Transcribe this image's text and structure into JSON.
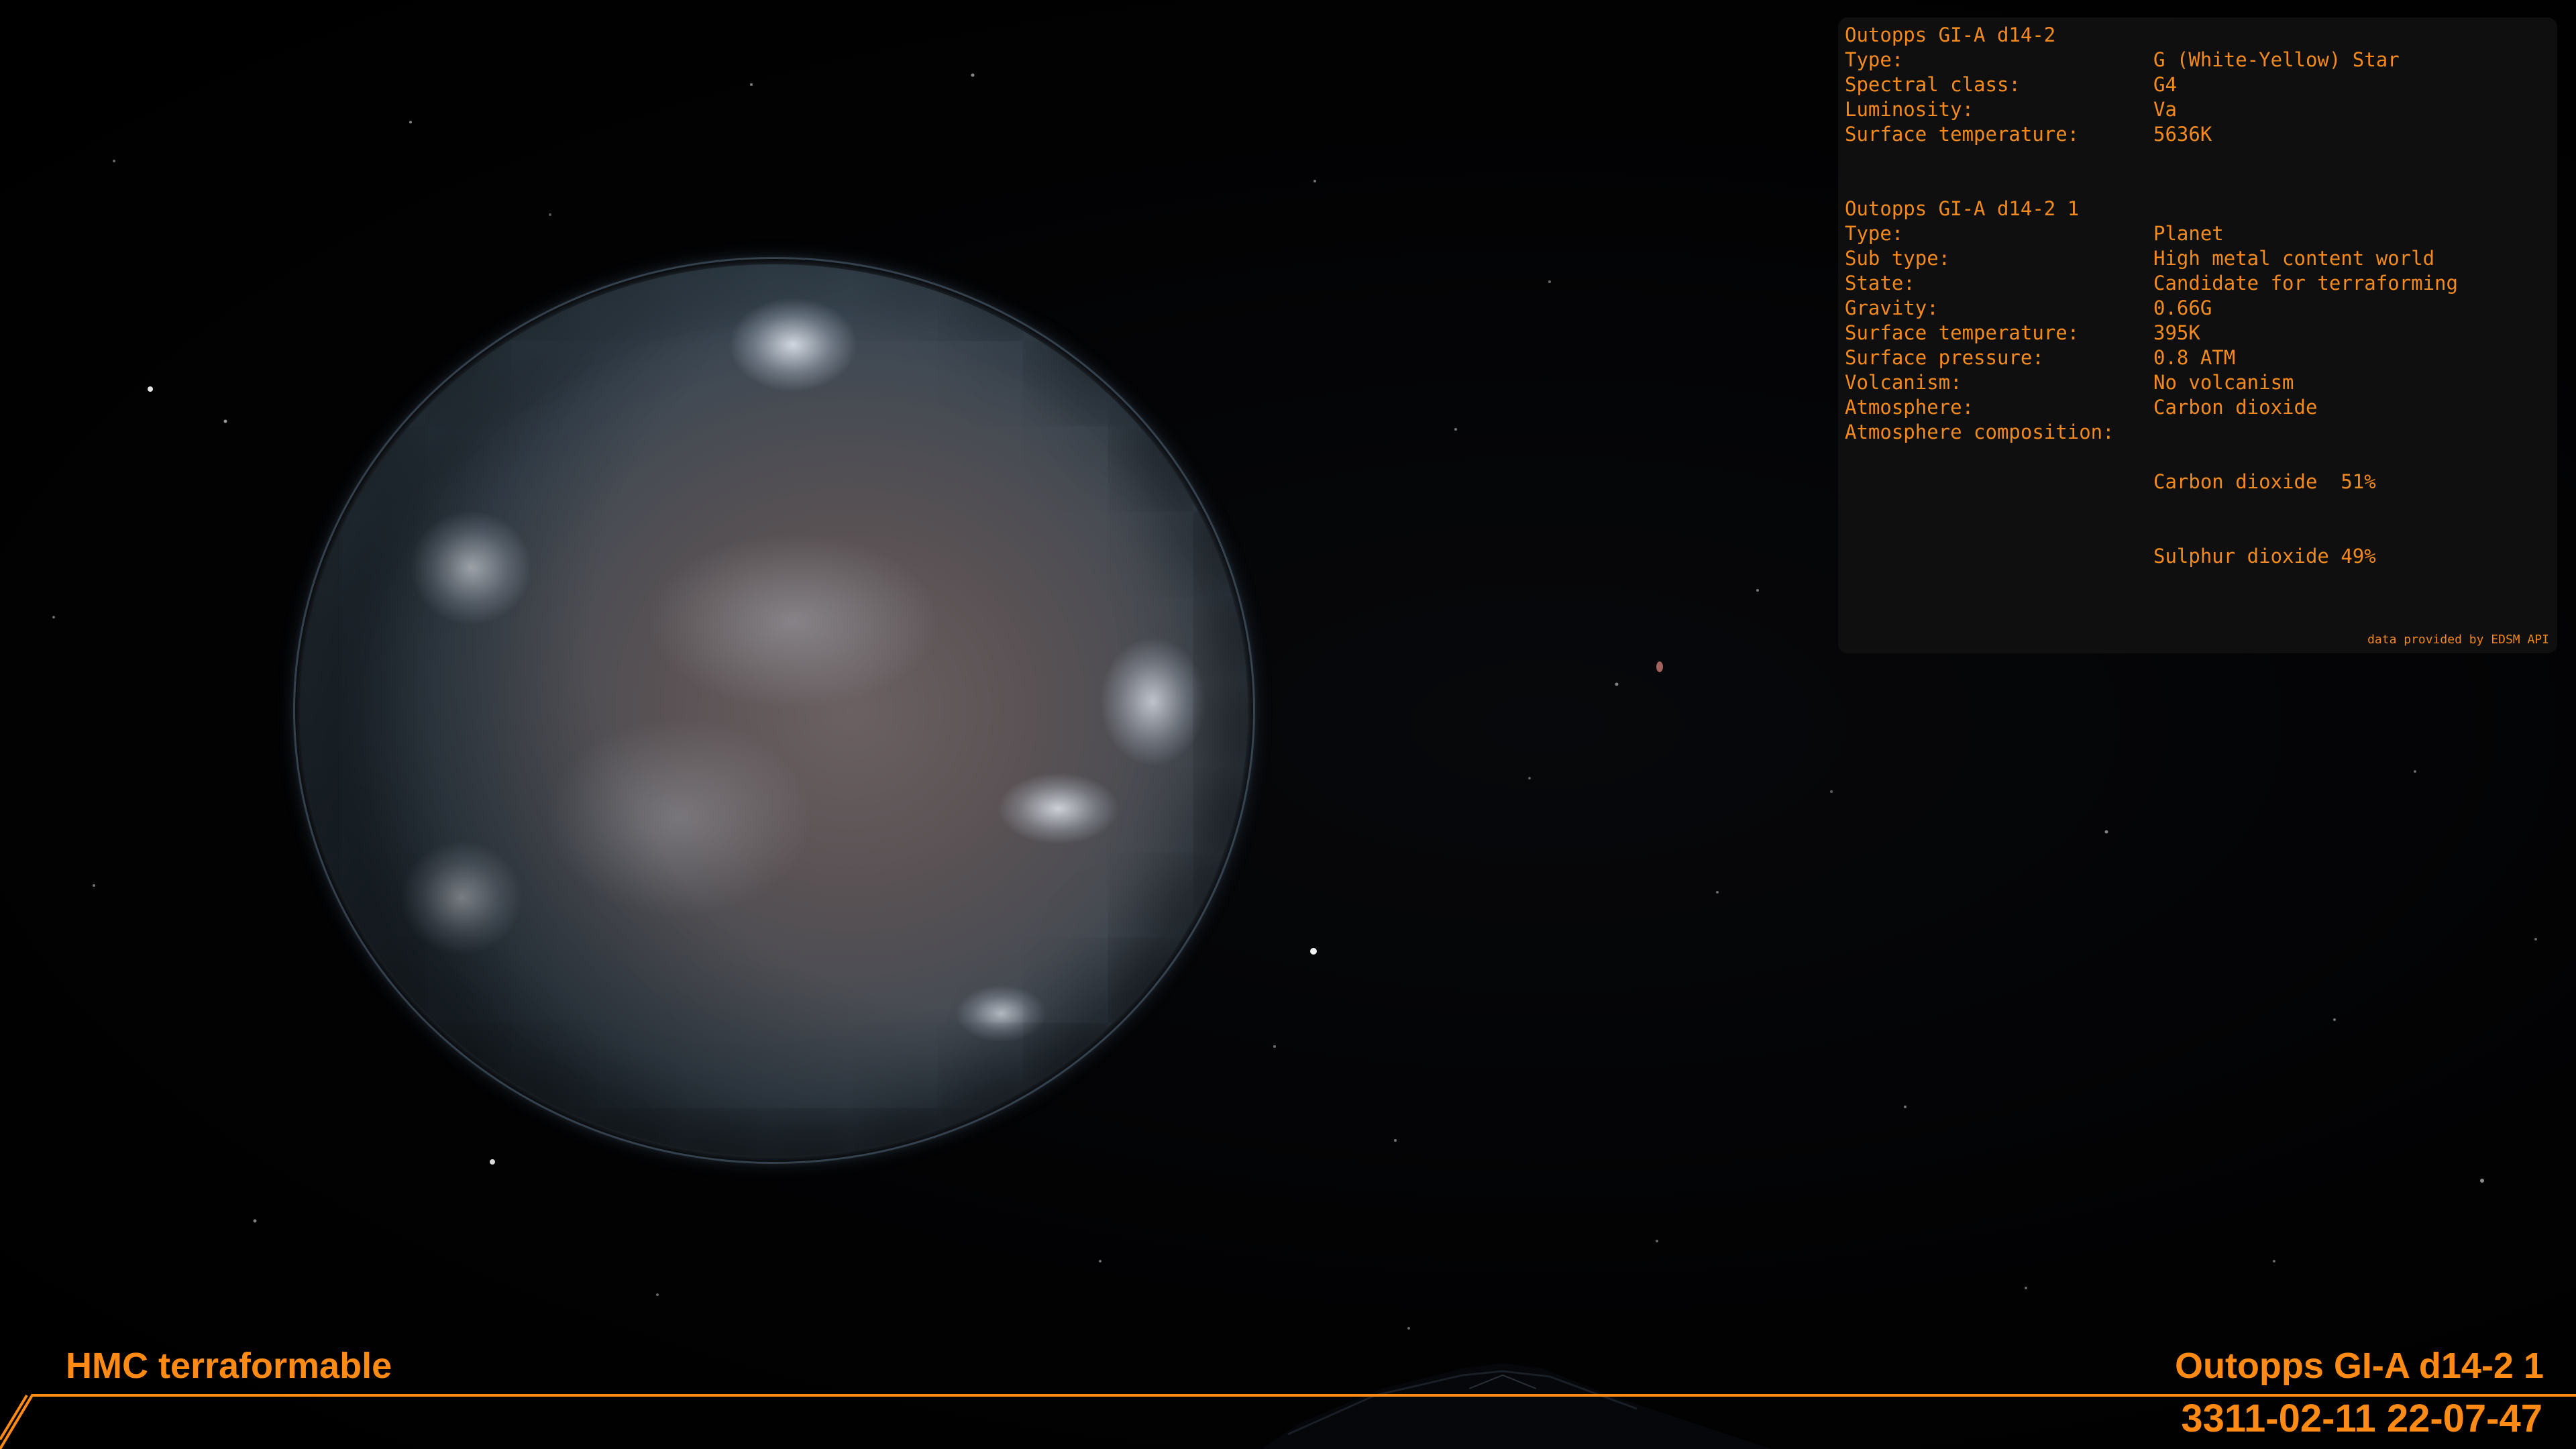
{
  "star": {
    "name": "Outopps GI-A d14-2",
    "rows": [
      {
        "label": "Type:",
        "value": "G (White-Yellow) Star"
      },
      {
        "label": "Spectral class:",
        "value": "G4"
      },
      {
        "label": "Luminosity:",
        "value": "Va"
      },
      {
        "label": "Surface temperature:",
        "value": "5636K"
      }
    ]
  },
  "planet": {
    "name": "Outopps GI-A d14-2 1",
    "rows": [
      {
        "label": "Type:",
        "value": "Planet"
      },
      {
        "label": "Sub type:",
        "value": "High metal content world"
      },
      {
        "label": "State:",
        "value": "Candidate for terraforming"
      },
      {
        "label": "Gravity:",
        "value": "0.66G"
      },
      {
        "label": "Surface temperature:",
        "value": "395K"
      },
      {
        "label": "Surface pressure:",
        "value": "0.8 ATM"
      },
      {
        "label": "Volcanism:",
        "value": "No volcanism"
      },
      {
        "label": "Atmosphere:",
        "value": "Carbon dioxide"
      }
    ],
    "composition_label": "Atmosphere composition:",
    "composition": [
      "Carbon dioxide  51%",
      "Sulphur dioxide 49%"
    ]
  },
  "panel_footer": "data provided by EDSM API",
  "hud": {
    "left_title": "HMC terraformable",
    "right_title": "Outopps GI-A d14-2 1",
    "datetime": "3311-02-11 22-07-47"
  },
  "colors": {
    "hud_orange": "#ff8a14",
    "panel_text": "#f28a1e",
    "panel_bg": "#101010"
  }
}
